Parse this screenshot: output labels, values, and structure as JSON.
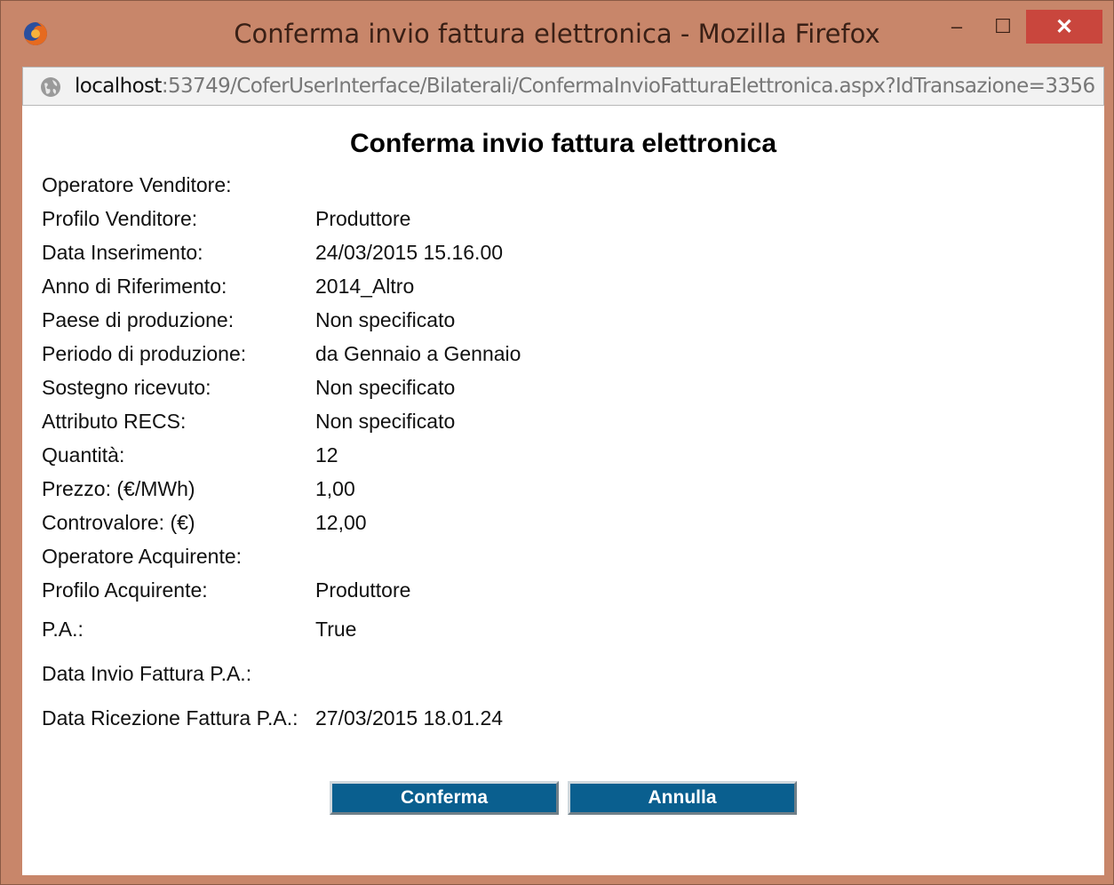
{
  "window": {
    "title": "Conferma invio fattura elettronica - Mozilla Firefox",
    "minimize": "–",
    "maximize": "☐",
    "close": "✕"
  },
  "address": {
    "host": "localhost",
    "rest": ":53749/CoferUserInterface/Bilaterali/ConfermaInvioFatturaElettronica.aspx?IdTransazione=3356"
  },
  "page": {
    "title": "Conferma invio fattura elettronica",
    "rows": [
      {
        "label": "Operatore Venditore:",
        "value": ""
      },
      {
        "label": "Profilo Venditore:",
        "value": "Produttore"
      },
      {
        "label": "Data Inserimento:",
        "value": "24/03/2015 15.16.00"
      },
      {
        "label": "Anno di Riferimento:",
        "value": "2014_Altro"
      },
      {
        "label": "Paese di produzione:",
        "value": "Non specificato"
      },
      {
        "label": "Periodo di produzione:",
        "value": "da Gennaio a Gennaio"
      },
      {
        "label": "Sostegno ricevuto:",
        "value": "Non specificato"
      },
      {
        "label": "Attributo RECS:",
        "value": "Non specificato"
      },
      {
        "label": "Quantità:",
        "value": "12"
      },
      {
        "label": "Prezzo: (€/MWh)",
        "value": "1,00"
      },
      {
        "label": "Controvalore: (€)",
        "value": "12,00"
      },
      {
        "label": "Operatore Acquirente:",
        "value": ""
      },
      {
        "label": "Profilo Acquirente:",
        "value": "Produttore"
      },
      {
        "label": "P.A.:",
        "value": "True"
      },
      {
        "label": "Data Invio Fattura P.A.:",
        "value": ""
      },
      {
        "label": "Data Ricezione Fattura P.A.:",
        "value": "27/03/2015 18.01.24"
      }
    ],
    "confirm_label": "Conferma",
    "cancel_label": "Annulla"
  }
}
